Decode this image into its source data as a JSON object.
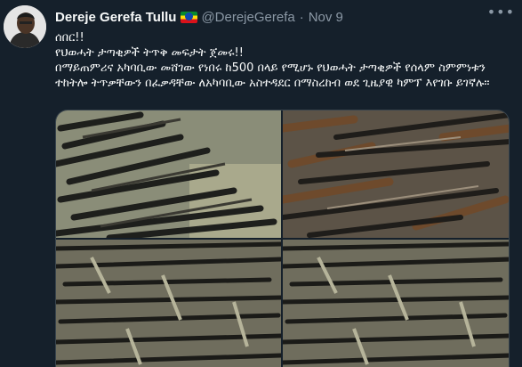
{
  "tweet": {
    "author_name": "Dereje Gerefa Tullu",
    "handle": "@DerejeGerefa",
    "separator": "·",
    "date": "Nov 9",
    "more_icon": "more-icon",
    "lines": [
      "ሰበር!!",
      "የህወሓት ታጣቂዎች ትጥቅ መፍታት ጀመሩ!!",
      "በማይጠምሪና አካባቢው መሸገው የነበሩ ከ500 በላይ የሚሆኑ የህወሓት ታጣቂዎች የሰላም ስምምነቱን",
      "ተከትሎ ትጥቃቸውን በፈቃዳቸው ለአካባቢው አስተዳደር በማስረከብ ወደ ጊዜያዊ ካምፕ እየገቡ ይገኛሉ።"
    ]
  },
  "colors": {
    "background": "#15202b",
    "text": "#f7f9f9",
    "muted": "#8b98a5",
    "border": "#38444d"
  },
  "media": {
    "photos": [
      "weapons-photo-1",
      "weapons-photo-2",
      "weapons-photo-3",
      "weapons-photo-4"
    ]
  }
}
